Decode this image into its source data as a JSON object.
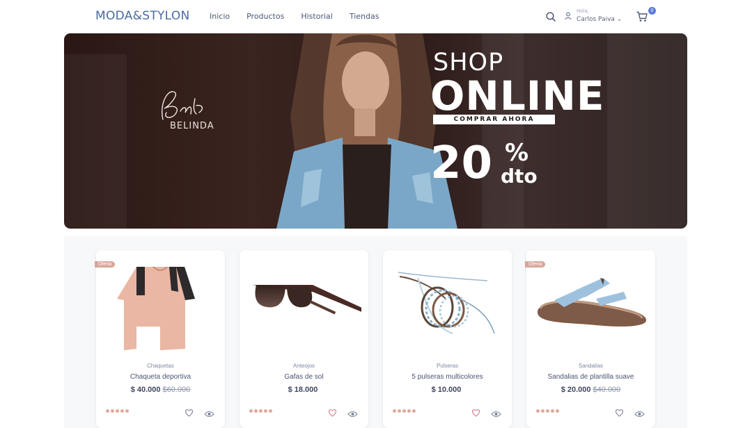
{
  "header": {
    "logo": "MODA&STYLON",
    "nav": [
      "Inicio",
      "Productos",
      "Historial",
      "Tiendas"
    ],
    "user_greeting": "Hola,",
    "user_name": "Carlos Paiva ⌄",
    "cart_count": "0"
  },
  "banner": {
    "signature_name": "BELINDA",
    "line1": "SHOP",
    "line2": "ONLINE",
    "cta": "COMPRAR AHORA",
    "discount_number": "20",
    "discount_percent": "%",
    "discount_suffix": "dto"
  },
  "products": [
    {
      "category": "Chaquetas",
      "name": "Chaqueta deportiva",
      "price": "$ 40.000",
      "old_price": "$60.000",
      "badge": "Oferta"
    },
    {
      "category": "Anteojos",
      "name": "Gafas de sol",
      "price": "$ 18.000",
      "old_price": "",
      "badge": ""
    },
    {
      "category": "Pulseras",
      "name": "5 pulseras multicolores",
      "price": "$ 10.000",
      "old_price": "",
      "badge": ""
    },
    {
      "category": "Sandalias",
      "name": "Sandalias de plantilla suave",
      "price": "$ 20.000",
      "old_price": "$40.000",
      "badge": "Oferta"
    }
  ],
  "colors": {
    "logo": "#4a6aa3",
    "badge": "#d9a59a",
    "stars": "#e2a99c",
    "cart_badge": "#5b7bd5"
  }
}
